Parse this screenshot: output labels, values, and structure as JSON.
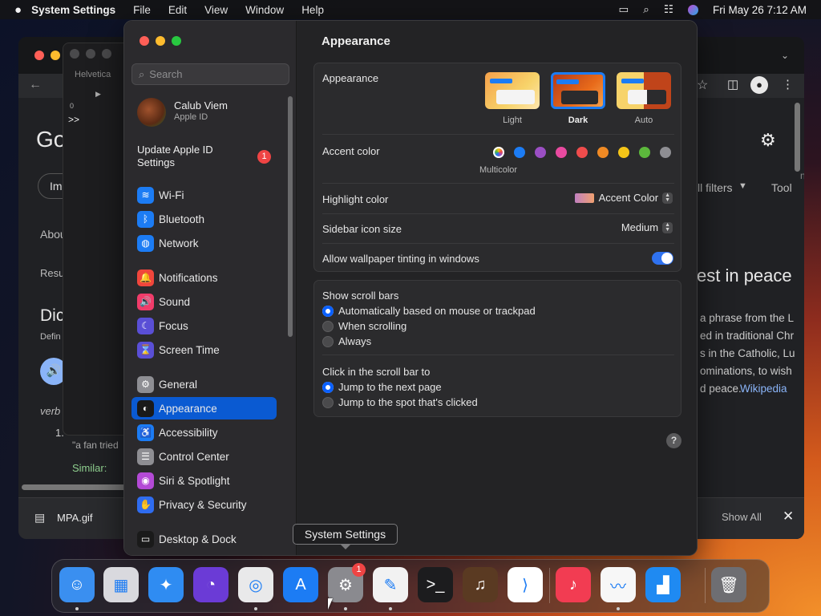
{
  "menubar": {
    "app": "System Settings",
    "items": [
      "File",
      "Edit",
      "View",
      "Window",
      "Help"
    ],
    "datetime": "Fri May 26  7:12 AM"
  },
  "browser": {
    "google_partial": "Go",
    "images_partial": "Ima",
    "about_partial": "Abou",
    "results_partial": "Resu",
    "dict_partial": "Dic",
    "defin_partial": "Defin",
    "verb_partial": "verb",
    "example_partial": "\"a fan tried",
    "num_partial": "1.",
    "similar_label": "Similar:",
    "filters_partial": "ll filters",
    "tools_partial": "Tool",
    "nag_partial": "nag",
    "heading_partial": "est in peace",
    "snippet_lines": [
      "a phrase from the L",
      "ed in traditional Chr",
      "s in the Catholic, Lu",
      "ominations, to wish",
      "d peace."
    ],
    "wikipedia": "Wikipedia",
    "download_file": "MPA.gif",
    "show_all": "Show All"
  },
  "editor": {
    "font": "Helvetica",
    "ruler_zero": "0",
    "cursor": ">>"
  },
  "settings": {
    "search_placeholder": "Search",
    "user": {
      "name": "Calub Viem",
      "subtitle": "Apple ID"
    },
    "update": {
      "label_line1": "Update Apple ID",
      "label_line2": "Settings",
      "badge": "1"
    },
    "sidebar": [
      {
        "label": "Wi-Fi",
        "color": "#1c7cf4",
        "icon": "wifi-icon",
        "glyph": "≋"
      },
      {
        "label": "Bluetooth",
        "color": "#1c7cf4",
        "icon": "bluetooth-icon",
        "glyph": "ᛒ"
      },
      {
        "label": "Network",
        "color": "#1c7cf4",
        "icon": "globe-icon",
        "glyph": "◍"
      },
      {
        "label": "Notifications",
        "color": "#f0463c",
        "icon": "bell-icon",
        "glyph": "🔔"
      },
      {
        "label": "Sound",
        "color": "#f03c6a",
        "icon": "speaker-icon",
        "glyph": "🔊"
      },
      {
        "label": "Focus",
        "color": "#5a4fd6",
        "icon": "moon-icon",
        "glyph": "☾"
      },
      {
        "label": "Screen Time",
        "color": "#5a4fd6",
        "icon": "hourglass-icon",
        "glyph": "⌛"
      },
      {
        "label": "General",
        "color": "#8e8e93",
        "icon": "gear-icon",
        "glyph": "⚙"
      },
      {
        "label": "Appearance",
        "color": "#1a1a1a",
        "icon": "appearance-icon",
        "glyph": "◐"
      },
      {
        "label": "Accessibility",
        "color": "#1c7cf4",
        "icon": "accessibility-icon",
        "glyph": "♿"
      },
      {
        "label": "Control Center",
        "color": "#8e8e93",
        "icon": "control-center-icon",
        "glyph": "☰"
      },
      {
        "label": "Siri & Spotlight",
        "color": "#b44ad6",
        "icon": "siri-icon",
        "glyph": "◉"
      },
      {
        "label": "Privacy & Security",
        "color": "#2f6cf0",
        "icon": "hand-icon",
        "glyph": "✋"
      },
      {
        "label": "Desktop & Dock",
        "color": "#1a1a1a",
        "icon": "dock-icon",
        "glyph": "▭"
      }
    ],
    "title": "Appearance",
    "appearance": {
      "label": "Appearance",
      "options": [
        "Light",
        "Dark",
        "Auto"
      ],
      "selected": "Dark"
    },
    "accent": {
      "label": "Accent color",
      "multicolor": "Multicolor",
      "colors": [
        "#1c7cf4",
        "#9b4fc4",
        "#e94aa0",
        "#ef4c4c",
        "#f08a24",
        "#f5c518",
        "#5cb83c",
        "#8e8e93"
      ]
    },
    "highlight": {
      "label": "Highlight color",
      "value": "Accent Color"
    },
    "sidebar_icon": {
      "label": "Sidebar icon size",
      "value": "Medium"
    },
    "tinting": {
      "label": "Allow wallpaper tinting in windows"
    },
    "scroll": {
      "label": "Show scroll bars",
      "options": [
        "Automatically based on mouse or trackpad",
        "When scrolling",
        "Always"
      ],
      "selected": 0
    },
    "click": {
      "label": "Click in the scroll bar to",
      "options": [
        "Jump to the next page",
        "Jump to the spot that's clicked"
      ],
      "selected": 0
    },
    "help": "?"
  },
  "tooltip": "System Settings",
  "dock": [
    {
      "name": "finder-icon",
      "bg": "#3a8ff0",
      "glyph": "☺",
      "dot": true
    },
    {
      "name": "launchpad-icon",
      "bg": "#d9d9de",
      "glyph": "▦",
      "dot": false
    },
    {
      "name": "safari-icon",
      "bg": "#2f8cf2",
      "glyph": "✦",
      "dot": false
    },
    {
      "name": "firefox-icon",
      "bg": "#6b3bd6",
      "glyph": "◔",
      "dot": false
    },
    {
      "name": "chrome-icon",
      "bg": "#e9e9ea",
      "glyph": "◎",
      "dot": true
    },
    {
      "name": "app-store-icon",
      "bg": "#1c7cf4",
      "glyph": "A",
      "dot": false
    },
    {
      "name": "system-settings-icon",
      "bg": "#8a8a8f",
      "glyph": "⚙",
      "dot": true,
      "badge": "1"
    },
    {
      "name": "textedit-icon",
      "bg": "#f2f2f2",
      "glyph": "✎",
      "dot": true
    },
    {
      "name": "terminal-icon",
      "bg": "#1c1c1e",
      "glyph": ">_",
      "dot": false
    },
    {
      "name": "garageband-icon",
      "bg": "#5a3a22",
      "glyph": "♫",
      "dot": false
    },
    {
      "name": "vscode-icon",
      "bg": "#ffffff",
      "glyph": "⟩",
      "dot": false
    },
    {
      "name": "music-icon",
      "bg": "#f23c52",
      "glyph": "♪",
      "dot": false
    },
    {
      "name": "freeform-icon",
      "bg": "#f7f7f7",
      "glyph": "〰",
      "dot": true
    },
    {
      "name": "keynote-icon",
      "bg": "#1f8af2",
      "glyph": "▟",
      "dot": false
    },
    {
      "name": "trash-icon",
      "bg": "#6e6e72",
      "glyph": "🗑",
      "dot": false
    }
  ]
}
